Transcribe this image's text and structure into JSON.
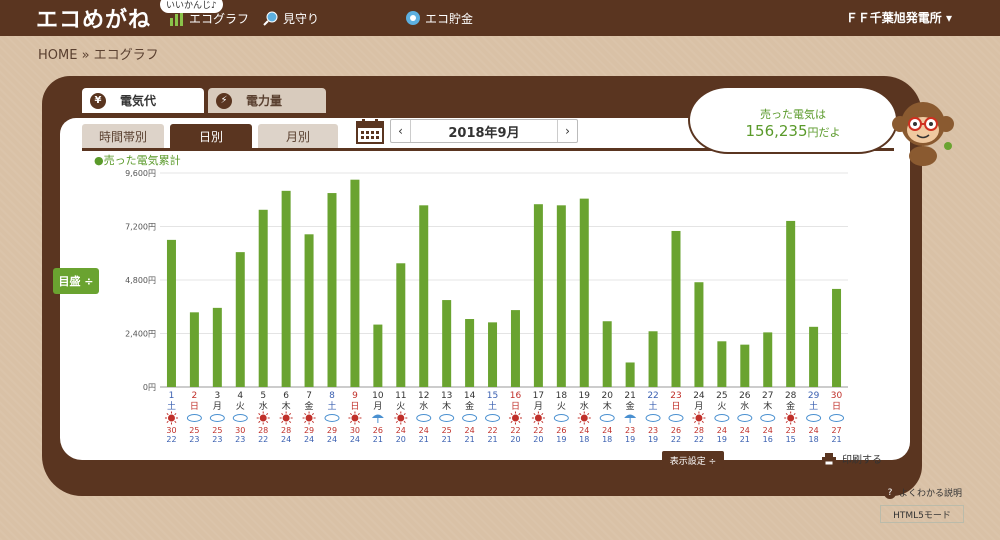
{
  "header": {
    "logo": "エコめがね",
    "nav": [
      {
        "label": "エコグラフ",
        "icon": "bar-chart-icon"
      },
      {
        "label": "見守り",
        "icon": "magnifier-icon"
      },
      {
        "label": "エコ貯金",
        "icon": "piggy-bank-icon"
      }
    ],
    "bubble": "いいかんじ♪",
    "site_name": "ＦＦ千葉旭発電所"
  },
  "breadcrumb": "HOME » エコグラフ",
  "tabs": {
    "electricity_cost": "電気代",
    "electricity_amount": "電力量"
  },
  "subtabs": [
    "時間帯別",
    "日別",
    "月別"
  ],
  "date_label": "2018年9月",
  "speech": {
    "line1": "売った電気は",
    "amount": "156,235",
    "suffix": "円だよ"
  },
  "series_label": "●売った電気累計",
  "mode_button": "目盛 ÷",
  "display_settings": "表示設定 ÷",
  "print_label": "印刷する",
  "help_label": "よくわかる説明",
  "html5_label": "HTML5モード",
  "colors": {
    "brown": "#5a3520",
    "green": "#6aa330",
    "saturday": "#3a5fb0",
    "sunday": "#c0302a",
    "weekday": "#333333"
  },
  "chart_data": {
    "type": "bar",
    "yticks": [
      "9,600円",
      "7,200円",
      "4,800円",
      "2,400円",
      "0円"
    ],
    "ylim": [
      0,
      9600
    ],
    "days": [
      "1",
      "2",
      "3",
      "4",
      "5",
      "6",
      "7",
      "8",
      "9",
      "10",
      "11",
      "12",
      "13",
      "14",
      "15",
      "16",
      "17",
      "18",
      "19",
      "20",
      "21",
      "22",
      "23",
      "24",
      "25",
      "26",
      "27",
      "28",
      "29",
      "30"
    ],
    "weekdays": [
      "土",
      "日",
      "月",
      "火",
      "水",
      "木",
      "金",
      "土",
      "日",
      "月",
      "火",
      "水",
      "木",
      "金",
      "土",
      "日",
      "月",
      "火",
      "水",
      "木",
      "金",
      "土",
      "日",
      "月",
      "火",
      "水",
      "木",
      "金",
      "土",
      "日"
    ],
    "values": [
      6600,
      3350,
      3550,
      6050,
      7950,
      8800,
      6850,
      8700,
      9300,
      2800,
      5550,
      8150,
      3900,
      3050,
      2900,
      3450,
      8200,
      8150,
      8450,
      2950,
      1100,
      2500,
      7000,
      4700,
      2050,
      1900,
      2450,
      7450,
      2700,
      4400
    ],
    "weather": [
      "sun",
      "cloud",
      "cloud",
      "cloud",
      "sun",
      "sun",
      "sun",
      "cloud",
      "sun",
      "rain",
      "sun",
      "cloud",
      "cloud",
      "cloud",
      "cloud",
      "sun",
      "sun",
      "cloud",
      "sun",
      "cloud",
      "rain",
      "cloud",
      "cloud",
      "sun",
      "cloud",
      "cloud",
      "cloud",
      "sun",
      "cloud",
      "cloud"
    ],
    "high": [
      "30",
      "25",
      "25",
      "30",
      "28",
      "28",
      "29",
      "29",
      "30",
      "26",
      "24",
      "24",
      "25",
      "24",
      "22",
      "22",
      "22",
      "26",
      "24",
      "24",
      "23",
      "23",
      "26",
      "28",
      "24",
      "24",
      "24",
      "23",
      "24",
      "27"
    ],
    "low": [
      "22",
      "23",
      "23",
      "23",
      "22",
      "24",
      "24",
      "24",
      "24",
      "21",
      "20",
      "21",
      "21",
      "21",
      "21",
      "20",
      "20",
      "19",
      "18",
      "18",
      "19",
      "19",
      "22",
      "22",
      "19",
      "21",
      "16",
      "15",
      "18",
      "21"
    ]
  }
}
